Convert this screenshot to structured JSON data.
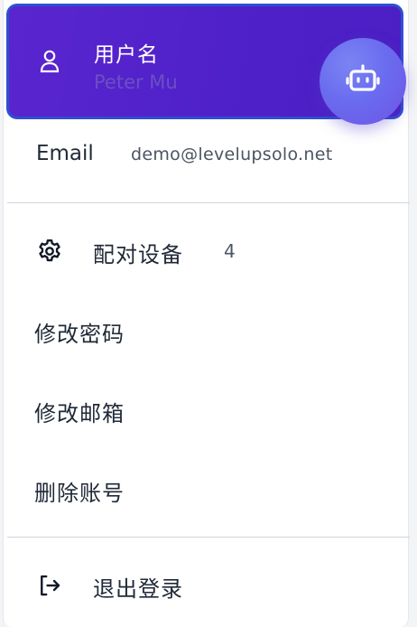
{
  "user": {
    "title": "用户名",
    "name": "Peter Mu"
  },
  "email": {
    "label": "Email",
    "value": "demo@levelupsolo.net"
  },
  "menu": {
    "paired_devices": {
      "label": "配对设备",
      "count": "4",
      "icon": "gear-icon"
    },
    "change_password": {
      "label": "修改密码"
    },
    "change_email": {
      "label": "修改邮箱"
    },
    "delete_account": {
      "label": "删除账号"
    },
    "logout": {
      "label": "退出登录",
      "icon": "logout-icon"
    }
  },
  "colors": {
    "card_gradient_start": "#5a25cf",
    "card_gradient_end": "#4b1fc4",
    "card_border": "#2f4fd1",
    "bot_button": "#6a6cef",
    "text": "#1f2937",
    "muted_text": "#4b5563"
  },
  "icons": {
    "user": "user-icon",
    "assistant": "robot-icon"
  }
}
